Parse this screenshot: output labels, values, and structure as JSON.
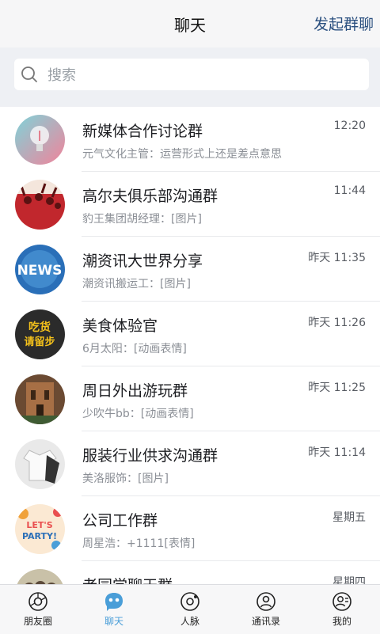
{
  "header": {
    "title": "聊天",
    "action_label": "发起群聊"
  },
  "search": {
    "placeholder": "搜索",
    "icon": "search-icon"
  },
  "chats": [
    {
      "name": "新媒体合作讨论群",
      "last_message": "元气文化主管：运营形式上还是差点意思",
      "time": "12:20",
      "avatar": "lightbulb"
    },
    {
      "name": "高尔夫俱乐部沟通群",
      "last_message": "豹王集团胡经理：[图片]",
      "time": "11:44",
      "avatar": "crowd"
    },
    {
      "name": "潮资讯大世界分享",
      "last_message": "潮资讯搬运工：[图片]",
      "time": "昨天 11:35",
      "avatar": "news"
    },
    {
      "name": "美食体验官",
      "last_message": "6月太阳：[动画表情]",
      "time": "昨天 11:26",
      "avatar": "foodie"
    },
    {
      "name": "周日外出游玩群",
      "last_message": "少吹牛bb：[动画表情]",
      "time": "昨天 11:25",
      "avatar": "building"
    },
    {
      "name": "服装行业供求沟通群",
      "last_message": "美洛服饰：[图片]",
      "time": "昨天 11:14",
      "avatar": "clothes"
    },
    {
      "name": "公司工作群",
      "last_message": "周星浩：+1111[表情]",
      "time": "星期五",
      "avatar": "party"
    },
    {
      "name": "老同学聊天群",
      "last_message": "",
      "time": "星期四",
      "avatar": "friends"
    }
  ],
  "avatar_text": {
    "news": "NEWS",
    "foodie_line1": "吃货",
    "foodie_line2": "请留步",
    "party_line1": "LET'S",
    "party_line2": "PARTY!"
  },
  "tabs": [
    {
      "label": "朋友圈",
      "icon": "camera-icon",
      "active": false
    },
    {
      "label": "聊天",
      "icon": "chat-icon",
      "active": true
    },
    {
      "label": "人脉",
      "icon": "contacts-icon",
      "active": false
    },
    {
      "label": "通讯录",
      "icon": "address-book-icon",
      "active": false
    },
    {
      "label": "我的",
      "icon": "profile-icon",
      "active": false
    }
  ],
  "colors": {
    "accent": "#4a9ed8",
    "header_action": "#2a4f7f"
  }
}
